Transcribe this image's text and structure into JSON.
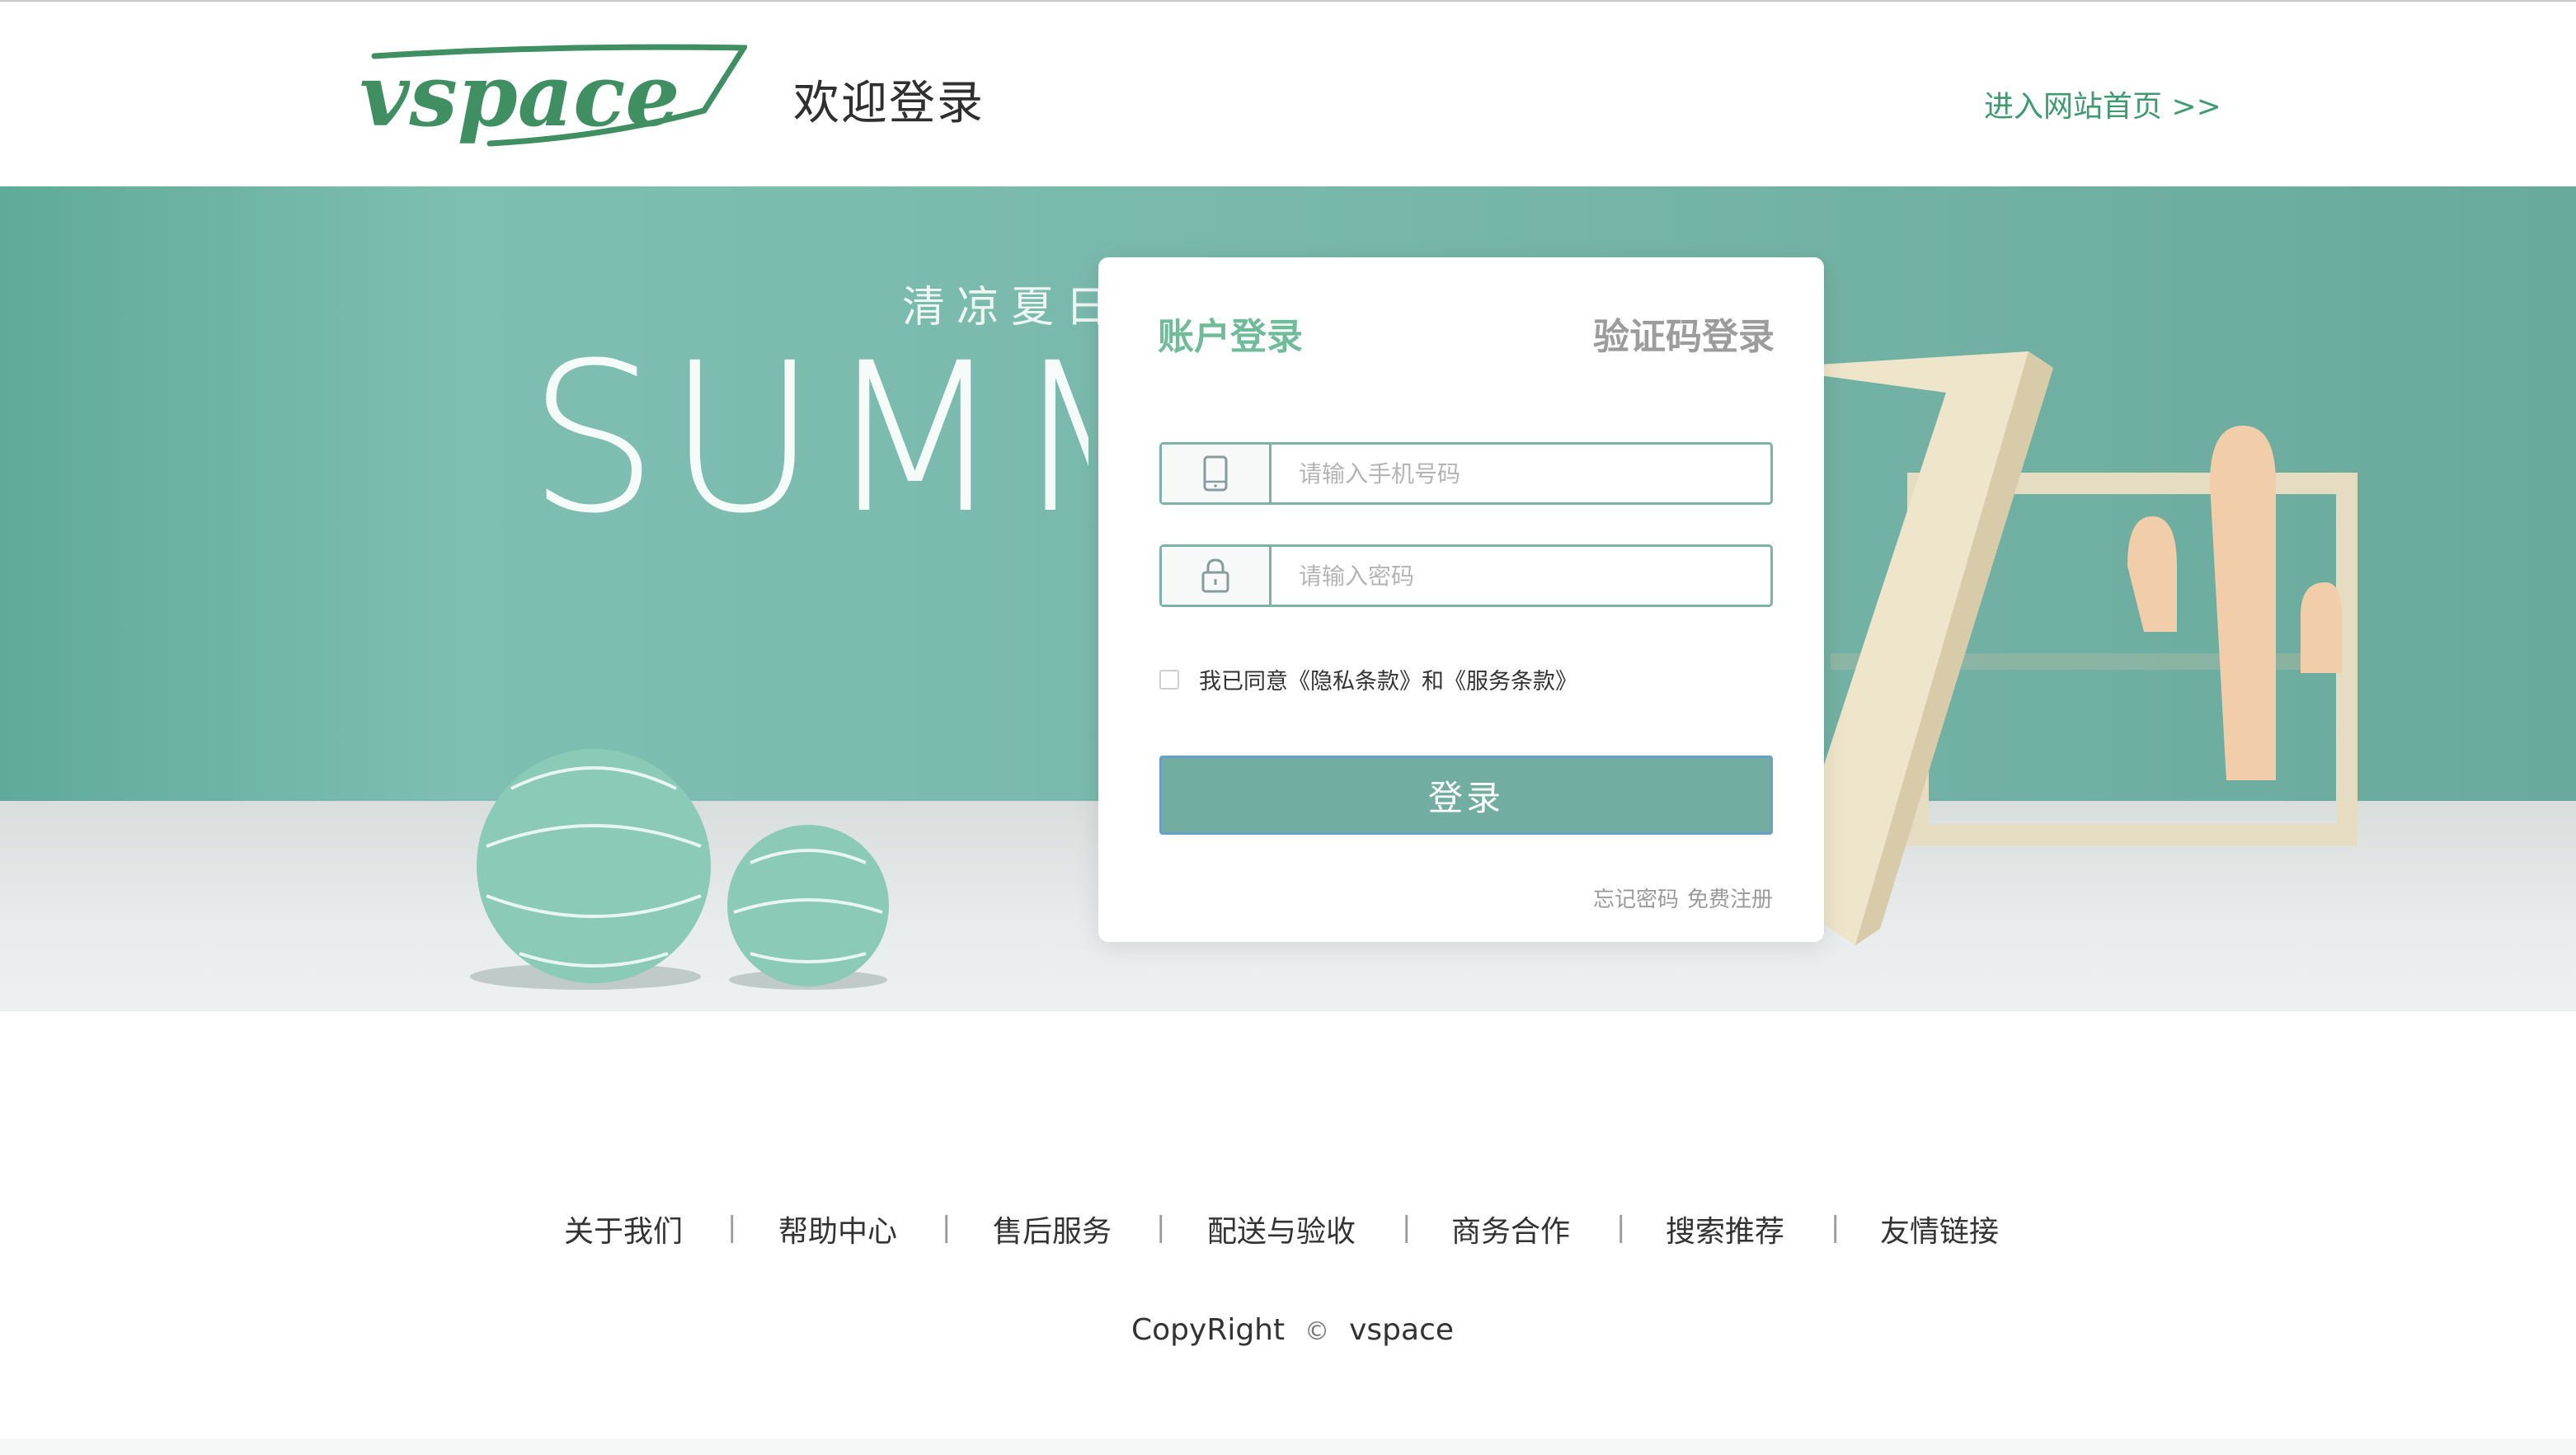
{
  "header": {
    "logo_text": "vspace",
    "welcome": "欢迎登录",
    "home_link": "进入网站首页 >>"
  },
  "banner": {
    "tagline": "清凉夏日",
    "headline": "SUMM"
  },
  "login": {
    "tab_account": "账户登录",
    "tab_code": "验证码登录",
    "phone_placeholder": "请输入手机号码",
    "password_placeholder": "请输入密码",
    "agree_text": "我已同意《隐私条款》和《服务条款》",
    "submit": "登录",
    "forgot": "忘记密码",
    "register": "免费注册"
  },
  "footer": {
    "links": [
      "关于我们",
      "帮助中心",
      "售后服务",
      "配送与验收",
      "商务合作",
      "搜索推荐",
      "友情链接"
    ],
    "separator": "|",
    "copyright_left": "CopyRight",
    "copyright_symbol": "©",
    "copyright_right": "vspace"
  },
  "colors": {
    "brand_green": "#3f9a6f",
    "banner_teal": "#79b8aa",
    "button": "#72ada1",
    "active_tab": "#6fbb9a"
  }
}
